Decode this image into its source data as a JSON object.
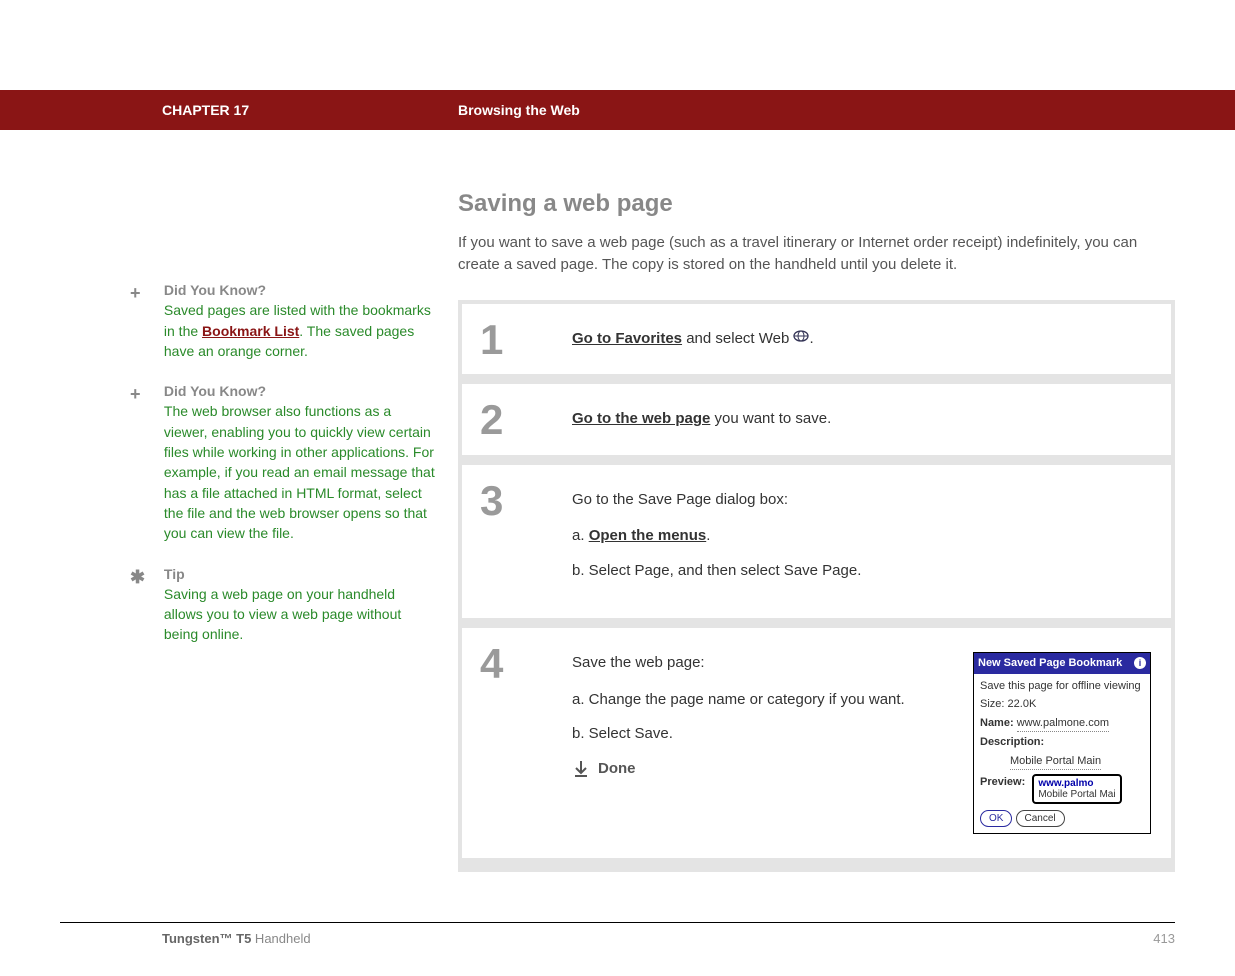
{
  "header": {
    "chapter": "CHAPTER 17",
    "title": "Browsing the Web"
  },
  "page": {
    "title": "Saving a web page",
    "intro": "If you want to save a web page (such as a travel itinerary or Internet order receipt) indefinitely, you can create a saved page. The copy is stored on the handheld until you delete it."
  },
  "sidebar": {
    "dyk1": {
      "title": "Did You Know?",
      "before": "Saved pages are listed with the bookmarks in the ",
      "link": "Bookmark List",
      "after": ". The saved pages have an orange corner."
    },
    "dyk2": {
      "title": "Did You Know?",
      "text": "The web browser also functions as a viewer, enabling you to quickly view certain files while working in other applications. For example, if you read an email message that has a file attached in HTML format, select the file and the web browser opens so that you can view the file."
    },
    "tip": {
      "title": "Tip",
      "text": "Saving a web page on your handheld allows you to view a web page without being online."
    }
  },
  "steps": {
    "s1": {
      "num": "1",
      "link": "Go to Favorites",
      "after": " and select Web ",
      "tail": "."
    },
    "s2": {
      "num": "2",
      "link": "Go to the web page",
      "after": " you want to save."
    },
    "s3": {
      "num": "3",
      "intro": "Go to the Save Page dialog box:",
      "a_prefix": "a.  ",
      "a_link": "Open the menus",
      "a_tail": ".",
      "b": "b.  Select Page, and then select Save Page."
    },
    "s4": {
      "num": "4",
      "intro": "Save the web page:",
      "a": "a.  Change the page name or category if you want.",
      "b": "b.  Select Save.",
      "done": "Done"
    }
  },
  "dialog": {
    "title": "New Saved Page Bookmark",
    "line1": "Save this page for offline viewing",
    "size_label": "Size:",
    "size_value": "22.0K",
    "name_label": "Name:",
    "name_value": "www.palmone.com",
    "desc_label": "Description:",
    "desc_value": "Mobile Portal Main",
    "preview_label": "Preview:",
    "preview_l1": "www.palmo",
    "preview_l2": "Mobile Portal Mai",
    "ok": "OK",
    "cancel": "Cancel"
  },
  "footer": {
    "product_bold": "Tungsten™ T5",
    "product_rest": " Handheld",
    "page": "413"
  }
}
